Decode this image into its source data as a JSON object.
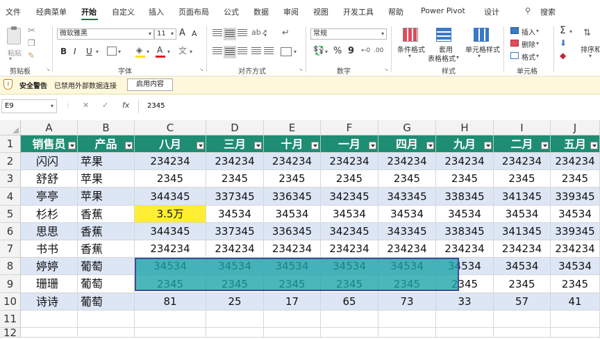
{
  "menu": {
    "tabs": [
      "文件",
      "经典菜单",
      "开始",
      "自定义",
      "插入",
      "页面布局",
      "公式",
      "数据",
      "审阅",
      "视图",
      "开发工具",
      "帮助",
      "Power Pivot",
      "设计"
    ],
    "active_tab": "开始",
    "search_label": "搜索"
  },
  "ribbon": {
    "clipboard": {
      "paste_label": "粘贴",
      "group_label": "剪贴板"
    },
    "font": {
      "font_name": "微软雅黑",
      "font_size": "11",
      "bold": "B",
      "italic": "I",
      "underline": "U",
      "grow": "A",
      "shrink": "A",
      "group_label": "字体",
      "fill_color": "#ffe000",
      "font_color": "#e81123"
    },
    "alignment": {
      "group_label": "对齐方式"
    },
    "number": {
      "format": "常规",
      "percent": "%",
      "comma": "9",
      "group_label": "数字"
    },
    "styles": {
      "cond_format": "条件格式",
      "table_format_1": "套用",
      "table_format_2": "表格格式",
      "cell_styles": "单元格样式",
      "group_label": "样式"
    },
    "cells": {
      "insert": "插入",
      "delete": "删除",
      "format": "格式",
      "group_label": "单元格"
    },
    "editing": {
      "sum": "Σ",
      "sort": "排序和"
    }
  },
  "security_bar": {
    "title": "安全警告",
    "message": "已禁用外部数据连接",
    "button": "启用内容"
  },
  "formula_bar": {
    "name_box": "E9",
    "cancel": "✕",
    "confirm": "✓",
    "fx": "fx",
    "value": "2345"
  },
  "grid": {
    "columns": [
      "A",
      "B",
      "C",
      "D",
      "E",
      "F",
      "G",
      "H",
      "I",
      "J"
    ],
    "rows": [
      "1",
      "2",
      "3",
      "4",
      "5",
      "6",
      "7",
      "8",
      "9",
      "10",
      "11",
      "12"
    ],
    "header_row": [
      "销售员",
      "产品",
      "八月",
      "三月",
      "十月",
      "一月",
      "四月",
      "九月",
      "二月",
      "五月"
    ],
    "data_rows": [
      [
        "闪闪",
        "苹果",
        "234234",
        "234234",
        "234234",
        "234234",
        "234234",
        "234234",
        "234234",
        "234234"
      ],
      [
        "舒舒",
        "苹果",
        "2345",
        "2345",
        "2345",
        "2345",
        "2345",
        "2345",
        "2345",
        "2345"
      ],
      [
        "亭亭",
        "苹果",
        "344345",
        "337345",
        "336345",
        "342345",
        "343345",
        "338345",
        "341345",
        "339345"
      ],
      [
        "杉杉",
        "香蕉",
        "3.5万",
        "34534",
        "34534",
        "34534",
        "34534",
        "34534",
        "34534",
        "34534"
      ],
      [
        "思思",
        "香蕉",
        "344345",
        "337345",
        "336345",
        "342345",
        "343345",
        "338345",
        "341345",
        "339345"
      ],
      [
        "书书",
        "香蕉",
        "234234",
        "234234",
        "234234",
        "234234",
        "234234",
        "234234",
        "234234",
        "234234"
      ],
      [
        "婷婷",
        "葡萄",
        "34534",
        "34534",
        "34534",
        "34534",
        "34534",
        "34534",
        "34534",
        "34534"
      ],
      [
        "珊珊",
        "葡萄",
        "2345",
        "2345",
        "2345",
        "2345",
        "2345",
        "2345",
        "2345",
        "2345"
      ],
      [
        "诗诗",
        "葡萄",
        "81",
        "25",
        "17",
        "65",
        "73",
        "33",
        "57",
        "41"
      ]
    ],
    "colors": {
      "header_bg": "#1e8d73",
      "band_bg": "#dde6f5",
      "highlight_cell_bg": "#ffee33",
      "drag_overlay": "#1aa3a8"
    }
  }
}
